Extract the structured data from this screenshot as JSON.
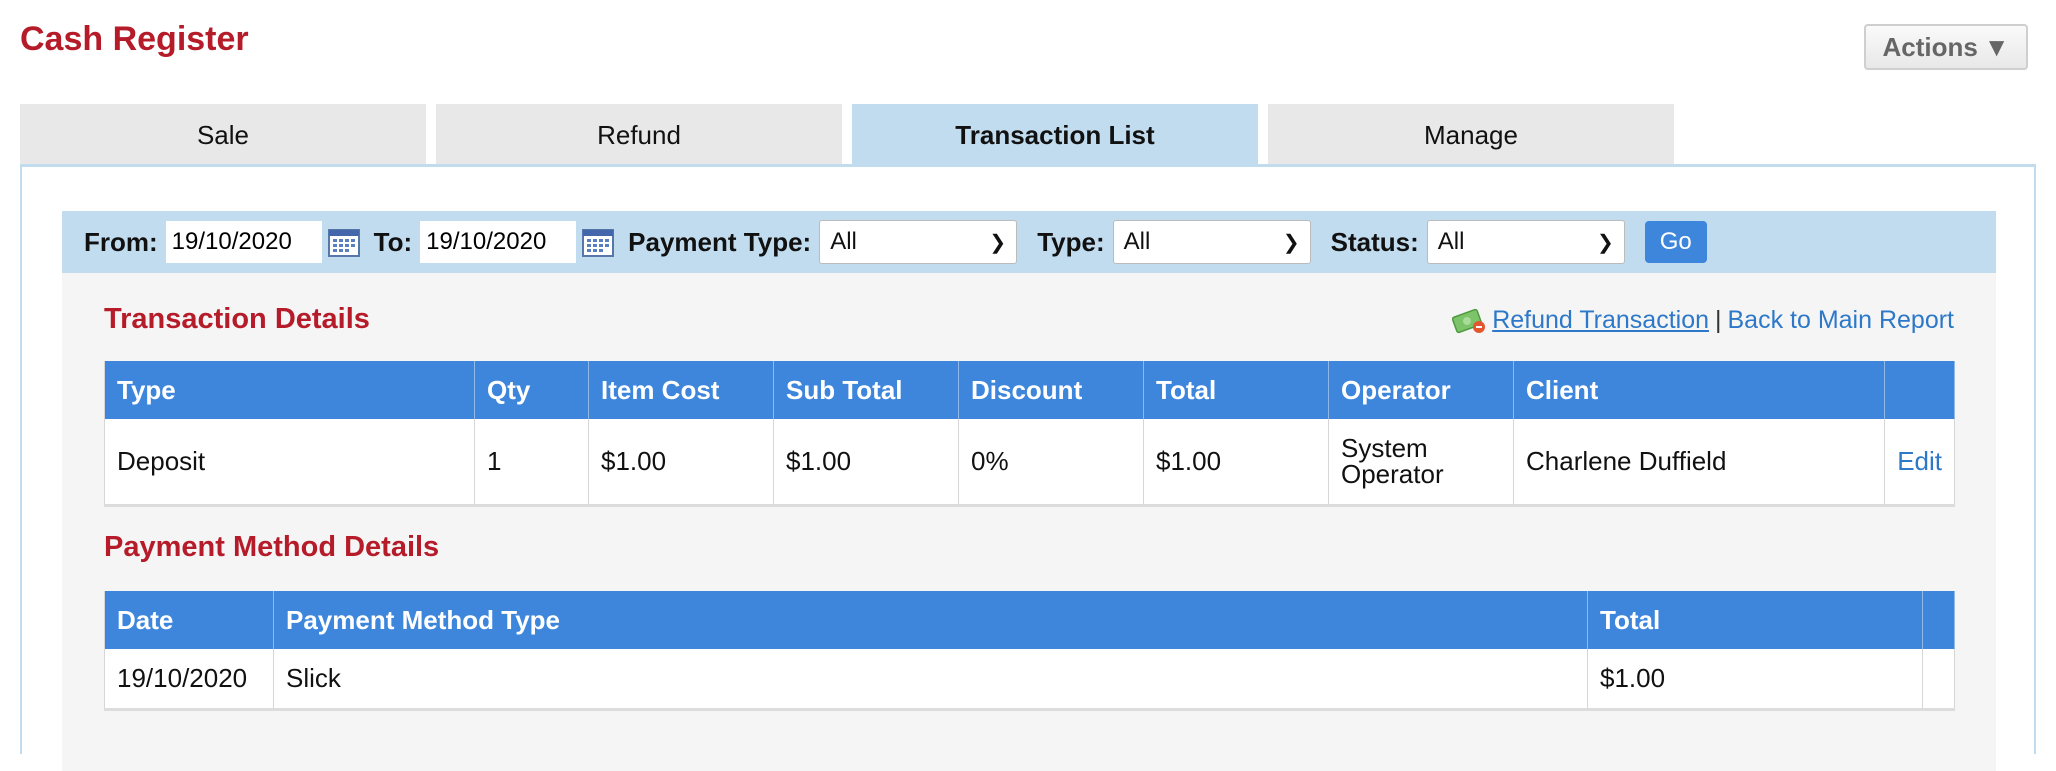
{
  "header": {
    "title": "Cash Register",
    "actions_label": "Actions",
    "actions_arrow": "▼"
  },
  "tabs": [
    {
      "label": "Sale",
      "active": false
    },
    {
      "label": "Refund",
      "active": false
    },
    {
      "label": "Transaction List",
      "active": true
    },
    {
      "label": "Manage",
      "active": false
    }
  ],
  "filters": {
    "from_label": "From:",
    "from_value": "19/10/2020",
    "to_label": "To:",
    "to_value": "19/10/2020",
    "payment_type_label": "Payment Type:",
    "payment_type_value": "All",
    "type_label": "Type:",
    "type_value": "All",
    "status_label": "Status:",
    "status_value": "All",
    "go_label": "Go"
  },
  "transaction_details": {
    "title": "Transaction Details",
    "refund_link": "Refund Transaction",
    "separator": "|",
    "back_link": "Back to Main Report",
    "columns": [
      "Type",
      "Qty",
      "Item Cost",
      "Sub Total",
      "Discount",
      "Total",
      "Operator",
      "Client",
      ""
    ],
    "rows": [
      {
        "type": "Deposit",
        "qty": "1",
        "item_cost": "$1.00",
        "sub_total": "$1.00",
        "discount": "0%",
        "total": "$1.00",
        "operator_line1": "System",
        "operator_line2": "Operator",
        "client": "Charlene Duffield",
        "action": "Edit"
      }
    ]
  },
  "payment_method_details": {
    "title": "Payment Method Details",
    "columns": [
      "Date",
      "Payment Method Type",
      "Total",
      ""
    ],
    "rows": [
      {
        "date": "19/10/2020",
        "method": "Slick",
        "total": "$1.00"
      }
    ]
  },
  "colors": {
    "brand_red": "#b61b2a",
    "table_header_blue": "#3d86dc",
    "filter_bar_blue": "#c2dcef",
    "link_blue": "#2d78c8"
  }
}
